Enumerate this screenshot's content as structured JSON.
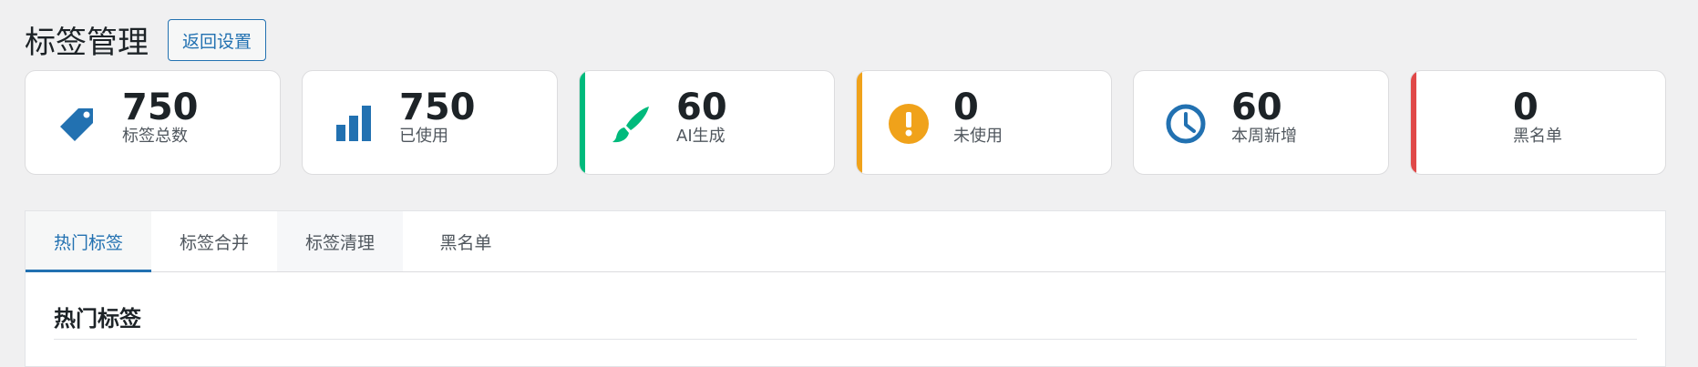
{
  "header": {
    "title": "标签管理",
    "back_button": "返回设置"
  },
  "stats": [
    {
      "value": "750",
      "label": "标签总数",
      "icon": "tag-icon",
      "color": "#2271b1"
    },
    {
      "value": "750",
      "label": "已使用",
      "icon": "bar-chart-icon",
      "color": "#2271b1"
    },
    {
      "value": "60",
      "label": "AI生成",
      "icon": "brush-icon",
      "color": "#00ba7c"
    },
    {
      "value": "0",
      "label": "未使用",
      "icon": "warning-icon",
      "color": "#f0a21a"
    },
    {
      "value": "60",
      "label": "本周新增",
      "icon": "clock-icon",
      "color": "#2271b1"
    },
    {
      "value": "0",
      "label": "黑名单",
      "icon": "none",
      "color": "#e04848"
    }
  ],
  "tabs": [
    {
      "label": "热门标签",
      "active": true
    },
    {
      "label": "标签合并",
      "active": false
    },
    {
      "label": "标签清理",
      "active": false
    },
    {
      "label": "黑名单",
      "active": false
    }
  ],
  "section": {
    "title": "热门标签"
  }
}
